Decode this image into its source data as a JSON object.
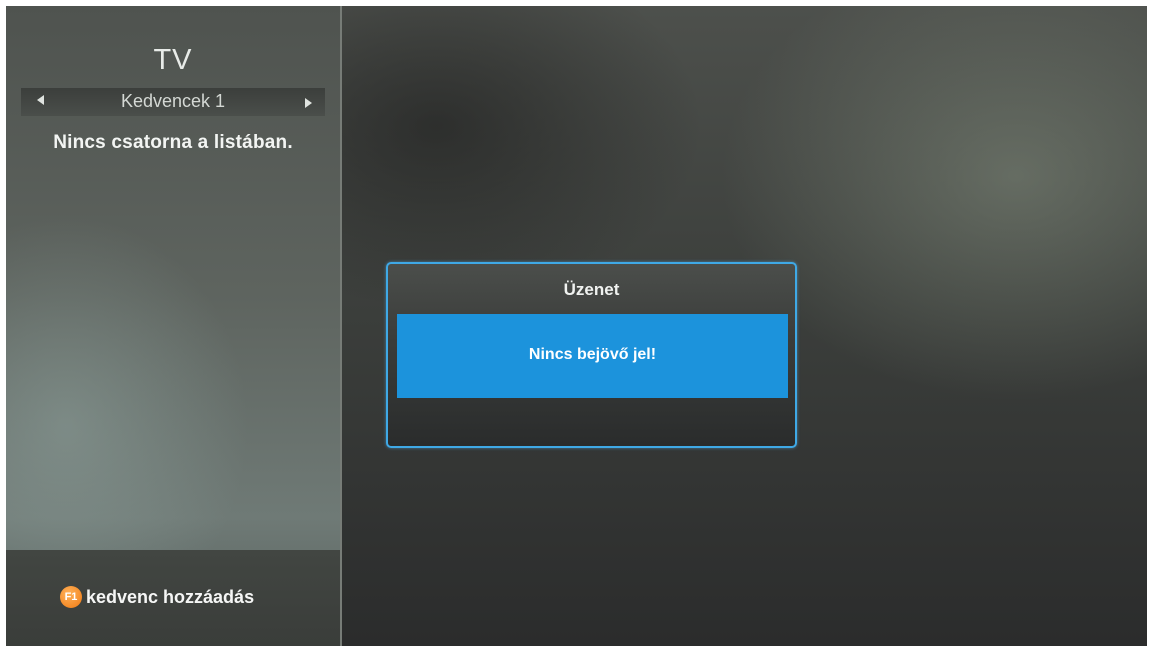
{
  "sidebar": {
    "title": "TV",
    "list_name": "Kedvencek 1",
    "empty_message": "Nincs csatorna a listában.",
    "footer": {
      "key_label": "F1",
      "key_color": "#f07a12",
      "action_label": "kedvenc hozzáadás"
    },
    "icons": [
      "arrow-left-icon",
      "arrow-right-icon"
    ]
  },
  "dialog": {
    "title": "Üzenet",
    "message": "Nincs bejövő jel!",
    "accent_color": "#3fa9e6",
    "highlight_color": "#1c93dc"
  }
}
